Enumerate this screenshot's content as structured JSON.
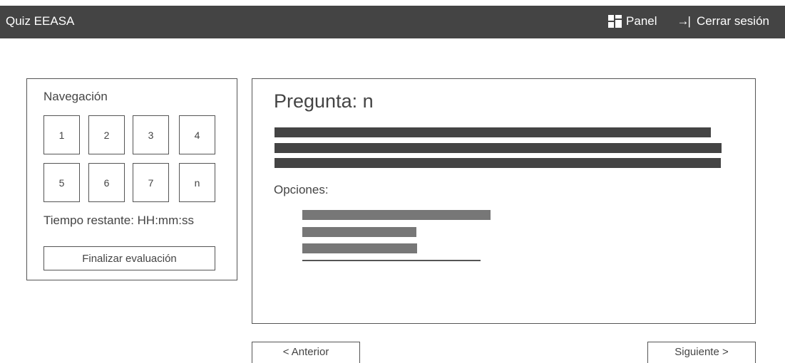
{
  "header": {
    "brand": "Quiz EEASA",
    "panel_label": "Panel",
    "logout_label": "Cerrar sesión",
    "bar_color": "#444444"
  },
  "navigation": {
    "title": "Navegación",
    "questions": [
      "1",
      "2",
      "3",
      "4",
      "5",
      "6",
      "7",
      "n"
    ],
    "timer": "Tiempo restante: HH:mm:ss",
    "finish_label": "Finalizar evaluación"
  },
  "question": {
    "title": "Pregunta: n",
    "options_label": "Opciones:"
  },
  "pager": {
    "prev_label": "< Anterior",
    "next_label": "Siguiente >"
  }
}
